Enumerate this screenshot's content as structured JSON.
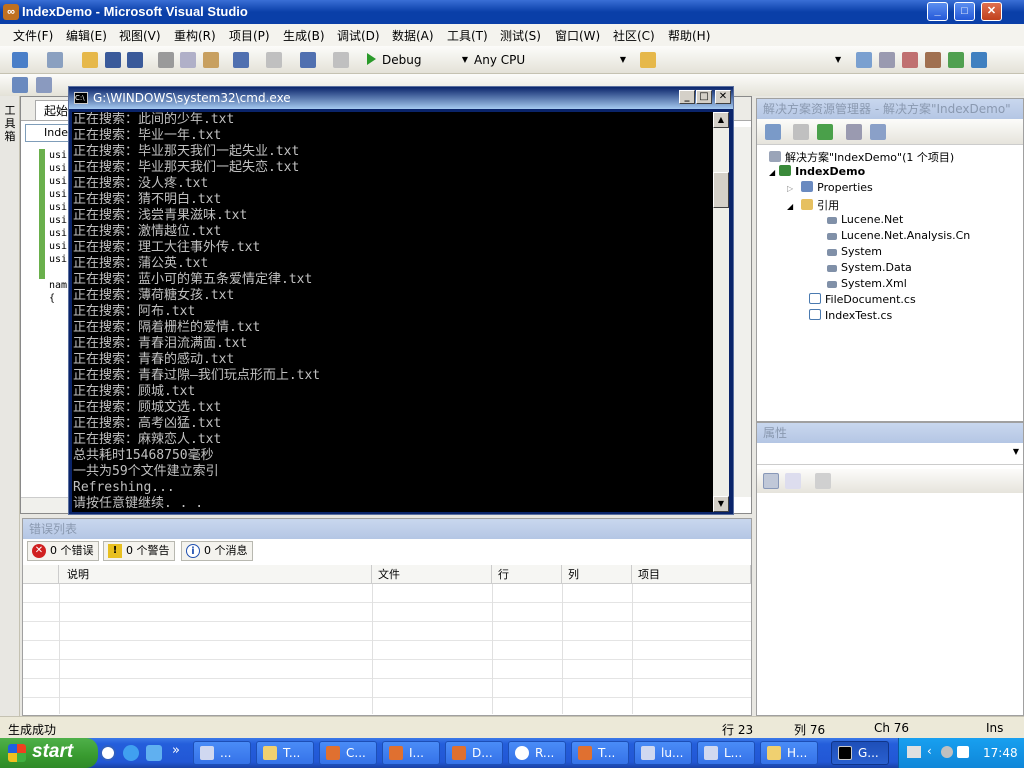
{
  "window": {
    "title": "IndexDemo - Microsoft Visual Studio",
    "controls": {
      "minimize": "_",
      "maximize": "□",
      "close": "✕"
    }
  },
  "menu": [
    "文件(F)",
    "编辑(E)",
    "视图(V)",
    "重构(R)",
    "项目(P)",
    "生成(B)",
    "调试(D)",
    "数据(A)",
    "工具(T)",
    "测试(S)",
    "窗口(W)",
    "社区(C)",
    "帮助(H)"
  ],
  "toolbar": {
    "config": "Debug",
    "platform": "Any CPU"
  },
  "left_strip": {
    "toolbox_label": "工具箱"
  },
  "editor": {
    "tab_label": "起始",
    "nav_combo": "Inde",
    "code_lines": [
      "usi",
      "usi",
      "usi",
      "usi",
      "usi",
      "usi",
      "usi",
      "usi",
      "usi",
      "",
      "nam",
      "{"
    ]
  },
  "cmd": {
    "title": "G:\\WINDOWS\\system32\\cmd.exe",
    "icon_text": "C:\\",
    "lines": [
      "正在搜索：此间的少年.txt",
      "正在搜索：毕业一年.txt",
      "正在搜索：毕业那天我们一起失业.txt",
      "正在搜索：毕业那天我们一起失恋.txt",
      "正在搜索：没人疼.txt",
      "正在搜索：猜不明白.txt",
      "正在搜索：浅尝青果滋味.txt",
      "正在搜索：激情越位.txt",
      "正在搜索：理工大往事外传.txt",
      "正在搜索：蒲公英.txt",
      "正在搜索：蓝小可的第五条爱情定律.txt",
      "正在搜索：薄荷糖女孩.txt",
      "正在搜索：阿布.txt",
      "正在搜索：隔着栅栏的爱情.txt",
      "正在搜索：青春泪流满面.txt",
      "正在搜索：青春的感动.txt",
      "正在搜索：青春过隙—我们玩点形而上.txt",
      "正在搜索：顾城.txt",
      "正在搜索：顾城文选.txt",
      "正在搜索：高考凶猛.txt",
      "正在搜索：麻辣恋人.txt",
      "总共耗时15468750毫秒",
      "一共为59个文件建立索引",
      "Refreshing...",
      "请按任意键继续. . ."
    ]
  },
  "error_list": {
    "title": "错误列表",
    "tabs": [
      "0 个错误",
      "0 个警告",
      "0 个消息"
    ],
    "columns": [
      "",
      "说明",
      "文件",
      "行",
      "列",
      "项目"
    ]
  },
  "solution_explorer": {
    "title": "解决方案资源管理器 - 解决方案\"IndexDemo\"",
    "items": [
      {
        "label": "解决方案\"IndexDemo\"(1 个项目)",
        "icon": "solution-icon"
      },
      {
        "label": "IndexDemo",
        "icon": "csharp-project-icon"
      },
      {
        "label": "Properties",
        "icon": "properties-icon"
      },
      {
        "label": "引用",
        "icon": "references-folder-icon"
      },
      {
        "label": "Lucene.Net",
        "icon": "reference-icon"
      },
      {
        "label": "Lucene.Net.Analysis.Cn",
        "icon": "reference-icon"
      },
      {
        "label": "System",
        "icon": "reference-icon"
      },
      {
        "label": "System.Data",
        "icon": "reference-icon"
      },
      {
        "label": "System.Xml",
        "icon": "reference-icon"
      },
      {
        "label": "FileDocument.cs",
        "icon": "cs-file-icon"
      },
      {
        "label": "IndexTest.cs",
        "icon": "cs-file-icon"
      }
    ]
  },
  "properties": {
    "title": "属性"
  },
  "statusbar": {
    "message": "生成成功",
    "line": "行 23",
    "col": "列 76",
    "ch": "Ch 76",
    "mode": "Ins"
  },
  "taskbar": {
    "start": "start",
    "buttons": [
      "...",
      "T...",
      "C...",
      "I...",
      "D...",
      "R...",
      "T...",
      "lu...",
      "L...",
      "H...",
      "G..."
    ],
    "clock": "17:48"
  },
  "colors": {
    "xp_blue": "#245edb",
    "start_green": "#389a2f",
    "console_bg": "#000000",
    "console_fg": "#c0c0c0"
  }
}
